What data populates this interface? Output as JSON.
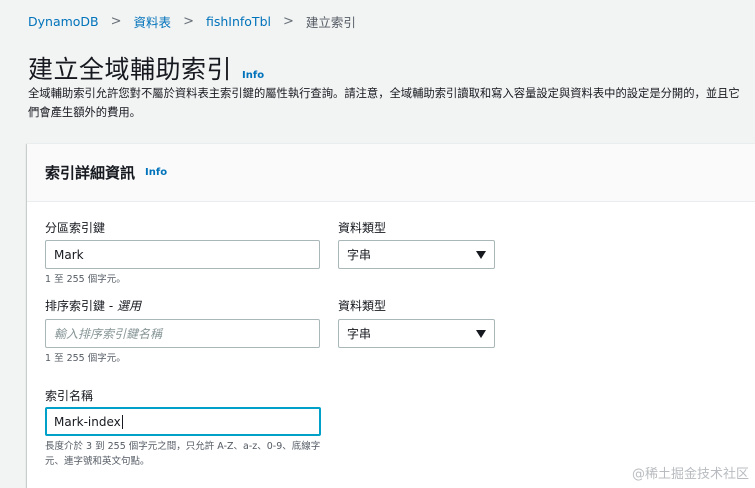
{
  "breadcrumb": {
    "items": [
      "DynamoDB",
      "資料表",
      "fishInfoTbl"
    ],
    "current": "建立索引",
    "separator": ">"
  },
  "page": {
    "title": "建立全域輔助索引",
    "info": "Info",
    "description": "全域輔助索引允許您對不屬於資料表主索引鍵的屬性執行查詢。請注意，全域輔助索引讀取和寫入容量設定與資料表中的設定是分開的，並且它們會產生額外的費用。"
  },
  "panel": {
    "title": "索引詳細資訊",
    "info": "Info",
    "partition_key": {
      "label": "分區索引鍵",
      "value": "Mark",
      "hint": "1 至 255 個字元。",
      "type_label": "資料類型",
      "type_value": "字串"
    },
    "sort_key": {
      "label": "排序索引鍵 - ",
      "optional": "選用",
      "placeholder": "輸入排序索引鍵名稱",
      "hint": "1 至 255 個字元。",
      "type_label": "資料類型",
      "type_value": "字串"
    },
    "index_name": {
      "label": "索引名稱",
      "value": "Mark-index",
      "hint": "長度介於 3 到 255 個字元之間，只允許 A-Z、a-z、0-9、底線字元、連字號和英文句點。"
    }
  },
  "watermark": "@稀土掘金技术社区",
  "icons": [
    "chevron-right-icon",
    "dropdown-caret-icon"
  ]
}
